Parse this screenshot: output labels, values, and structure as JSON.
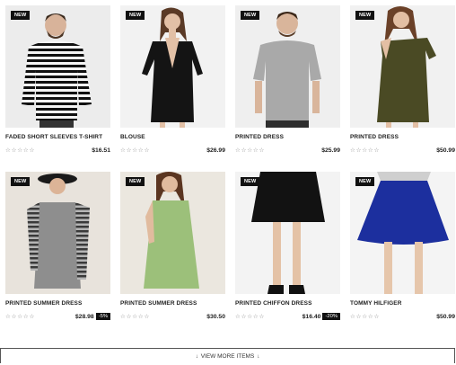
{
  "products": [
    {
      "badge": "NEW",
      "name": "FADED SHORT SLEEVES T-SHIRT",
      "stars": "☆☆☆☆☆",
      "price": "$16.51",
      "discount": ""
    },
    {
      "badge": "NEW",
      "name": "BLOUSE",
      "stars": "☆☆☆☆☆",
      "price": "$26.99",
      "discount": ""
    },
    {
      "badge": "NEW",
      "name": "PRINTED DRESS",
      "stars": "☆☆☆☆☆",
      "price": "$25.99",
      "discount": ""
    },
    {
      "badge": "NEW",
      "name": "PRINTED DRESS",
      "stars": "☆☆☆☆☆",
      "price": "$50.99",
      "discount": ""
    },
    {
      "badge": "NEW",
      "name": "PRINTED SUMMER DRESS",
      "stars": "☆☆☆☆☆",
      "price": "$28.98",
      "discount": "-5%"
    },
    {
      "badge": "NEW",
      "name": "PRINTED SUMMER DRESS",
      "stars": "☆☆☆☆☆",
      "price": "$30.50",
      "discount": ""
    },
    {
      "badge": "NEW",
      "name": "PRINTED CHIFFON DRESS",
      "stars": "☆☆☆☆☆",
      "price": "$16.40",
      "discount": "-20%"
    },
    {
      "badge": "NEW",
      "name": "TOMMY HILFIGER",
      "stars": "☆☆☆☆☆",
      "price": "$50.99",
      "discount": ""
    }
  ],
  "view_more": {
    "label": "VIEW MORE ITEMS",
    "icon_left": "down-arrow-icon",
    "icon_right": "down-arrow-icon"
  },
  "colors": {
    "badge_bg": "#111111",
    "price_text": "#222222"
  }
}
